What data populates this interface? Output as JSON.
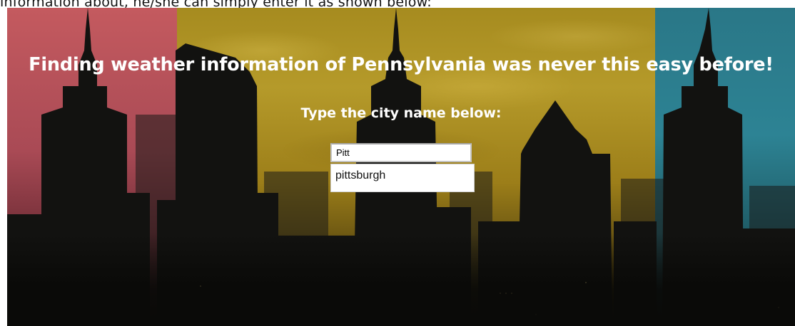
{
  "doc": {
    "text": "information about, he/she can simply enter it as shown below:"
  },
  "hero": {
    "title": "Finding weather information of Pennsylvania was never this easy before!",
    "subtitle": "Type the city name below:",
    "panel_colors": {
      "left": "#c45a5f",
      "middle": "#b59a2a",
      "right": "#2d8394"
    }
  },
  "search": {
    "value": "Pitt",
    "suggestions": [
      {
        "label": "pittsburgh"
      }
    ]
  }
}
